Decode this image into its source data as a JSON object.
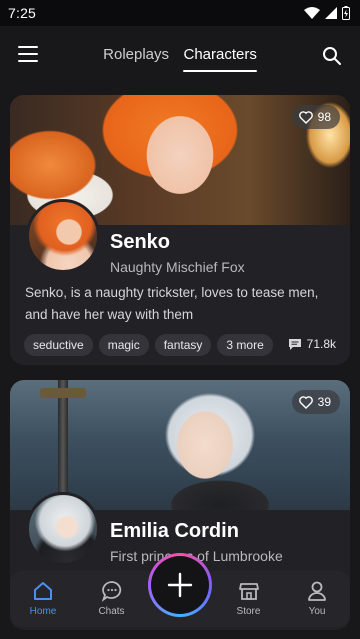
{
  "status_bar": {
    "time": "7:25"
  },
  "header": {
    "tabs": [
      {
        "label": "Roleplays",
        "active": false
      },
      {
        "label": "Characters",
        "active": true
      }
    ]
  },
  "cards": [
    {
      "likes": "98",
      "name": "Senko",
      "subtitle": "Naughty Mischief Fox",
      "description": "Senko, is a naughty trickster, loves to tease men, and have her way with them",
      "tags": [
        "seductive",
        "magic",
        "fantasy",
        "3 more"
      ],
      "chats": "71.8k"
    },
    {
      "likes": "39",
      "name": "Emilia Cordin",
      "subtitle": "First princess of Lumbrooke"
    }
  ],
  "bottom_nav": {
    "items": [
      {
        "label": "Home",
        "icon": "home-icon",
        "active": true
      },
      {
        "label": "Chats",
        "icon": "chat-bubble-icon",
        "active": false
      },
      {
        "label": "Store",
        "icon": "store-icon",
        "active": false
      },
      {
        "label": "You",
        "icon": "user-icon",
        "active": false
      }
    ]
  },
  "colors": {
    "background": "#18181b",
    "card": "#222226",
    "accent": "#4b8ff5"
  }
}
